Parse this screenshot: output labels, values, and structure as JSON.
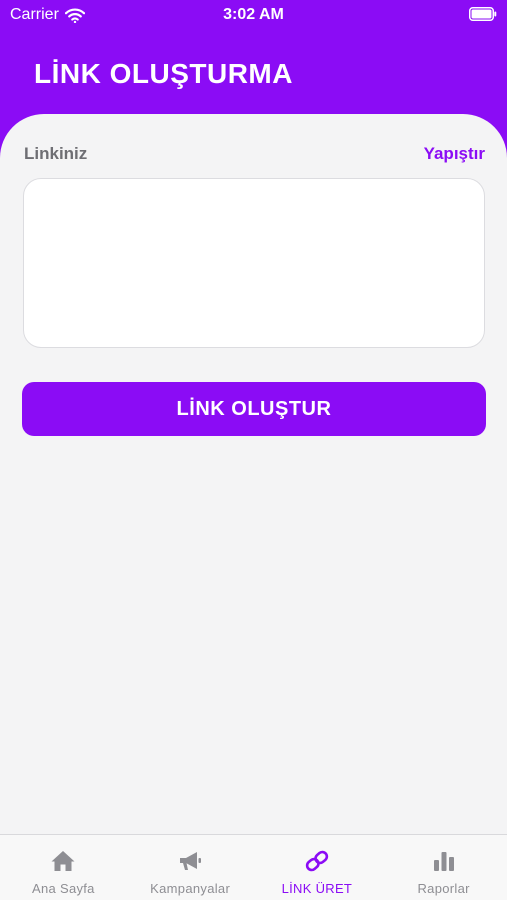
{
  "status_bar": {
    "carrier": "Carrier",
    "time": "3:02 AM",
    "icons": [
      "wifi-icon",
      "battery-icon"
    ]
  },
  "header": {
    "title": "LİNK OLUŞTURMA"
  },
  "form": {
    "label": "Linkiniz",
    "paste_label": "Yapıştır",
    "link_value": "",
    "create_button_label": "LİNK OLUŞTUR"
  },
  "tabs": [
    {
      "label": "Ana Sayfa",
      "icon": "home-icon",
      "active": false
    },
    {
      "label": "Kampanyalar",
      "icon": "megaphone-icon",
      "active": false
    },
    {
      "label": "LİNK ÜRET",
      "icon": "link-icon",
      "active": true
    },
    {
      "label": "Raporlar",
      "icon": "bar-chart-icon",
      "active": false
    }
  ],
  "colors": {
    "brand": "#8b0cf5",
    "background": "#f4f4f5",
    "muted_text": "#6e6e73",
    "inactive_tab": "#8e8e93"
  }
}
